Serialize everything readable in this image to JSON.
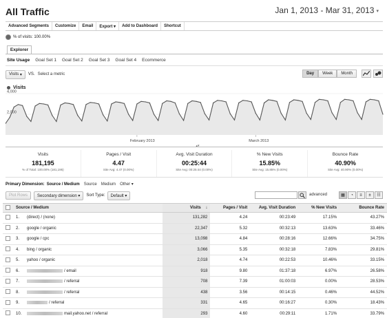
{
  "header": {
    "title": "All Traffic",
    "date_range": "Jan 1, 2013 - Mar 31, 2013"
  },
  "toolbar": [
    "Advanced Segments",
    "Customize",
    "Email",
    "Export ▾",
    "Add to Dashboard",
    "Shortcut"
  ],
  "segment": {
    "label": "% of visits: 100.00%"
  },
  "explorer_tab": "Explorer",
  "subtabs": [
    "Site Usage",
    "Goal Set 1",
    "Goal Set 2",
    "Goal Set 3",
    "Goal Set 4",
    "Ecommerce"
  ],
  "metric_row": {
    "metric_select": "Visits",
    "vs": "VS.",
    "select_metric": "Select a metric",
    "periods": [
      "Day",
      "Week",
      "Month"
    ],
    "active_period": "Day"
  },
  "chart_data": {
    "type": "line",
    "title": "",
    "legend": "Visits",
    "ylabel": "",
    "xlabel": "",
    "y_ticks": [
      "4,000",
      "2,000"
    ],
    "x_tick_labels": [
      "February 2013",
      "March 2013"
    ],
    "ylim": [
      0,
      4000
    ],
    "x": [
      "Jan 1",
      "Jan 2",
      "Jan 3",
      "Jan 4",
      "Jan 5",
      "Jan 6",
      "Jan 7",
      "Jan 8",
      "Jan 9",
      "Jan 10",
      "Jan 11",
      "Jan 12",
      "Jan 13",
      "Jan 14",
      "Jan 15",
      "Jan 16",
      "Jan 17",
      "Jan 18",
      "Jan 19",
      "Jan 20",
      "Jan 21",
      "Jan 22",
      "Jan 23",
      "Jan 24",
      "Jan 25",
      "Jan 26",
      "Jan 27",
      "Jan 28",
      "Jan 29",
      "Jan 30",
      "Jan 31",
      "Feb 1",
      "Feb 2",
      "Feb 3",
      "Feb 4",
      "Feb 5",
      "Feb 6",
      "Feb 7",
      "Feb 8",
      "Feb 9",
      "Feb 10",
      "Feb 11",
      "Feb 12",
      "Feb 13",
      "Feb 14",
      "Feb 15",
      "Feb 16",
      "Feb 17",
      "Feb 18",
      "Feb 19",
      "Feb 20",
      "Feb 21",
      "Feb 22",
      "Feb 23",
      "Feb 24",
      "Feb 25",
      "Feb 26",
      "Feb 27",
      "Feb 28",
      "Mar 1",
      "Mar 2",
      "Mar 3",
      "Mar 4",
      "Mar 5",
      "Mar 6",
      "Mar 7",
      "Mar 8",
      "Mar 9",
      "Mar 10",
      "Mar 11",
      "Mar 12",
      "Mar 13",
      "Mar 14",
      "Mar 15",
      "Mar 16",
      "Mar 17",
      "Mar 18",
      "Mar 19",
      "Mar 20",
      "Mar 21",
      "Mar 22",
      "Mar 23",
      "Mar 24",
      "Mar 25",
      "Mar 26",
      "Mar 27",
      "Mar 28",
      "Mar 29",
      "Mar 30",
      "Mar 31"
    ],
    "series": [
      {
        "name": "Visits",
        "values": [
          1100,
          1700,
          2700,
          2950,
          2850,
          1800,
          1300,
          2800,
          3050,
          3000,
          2900,
          1900,
          1300,
          2900,
          3100,
          3050,
          2950,
          1900,
          1350,
          2950,
          3150,
          3100,
          3000,
          1950,
          1350,
          3000,
          3200,
          3150,
          3050,
          2000,
          1400,
          3000,
          3250,
          3200,
          3100,
          2000,
          1400,
          3050,
          3300,
          3250,
          3100,
          2050,
          1400,
          3050,
          3300,
          3250,
          3150,
          2050,
          1450,
          3100,
          3350,
          3300,
          3200,
          2050,
          1450,
          3100,
          3350,
          3300,
          3200,
          2100,
          1450,
          3100,
          3400,
          3350,
          3250,
          2100,
          1450,
          3150,
          3400,
          3350,
          3250,
          2100,
          1500,
          3150,
          3450,
          3400,
          3300,
          2150,
          1500,
          3150,
          3450,
          3400,
          3300,
          2150,
          1500,
          3200,
          3450,
          3400,
          3300,
          2000
        ]
      }
    ],
    "color": "#555555",
    "fill": "#e9e9e9",
    "grid": true
  },
  "summary": [
    {
      "label": "Visits",
      "value": "181,195",
      "sub": "% of Total: 100.00% (181,195)"
    },
    {
      "label": "Pages / Visit",
      "value": "4.47",
      "sub": "Site Avg: 4.47 (0.00%)"
    },
    {
      "label": "Avg. Visit Duration",
      "value": "00:25:44",
      "sub": "Site Avg: 00:25:44 (0.00%)"
    },
    {
      "label": "% New Visits",
      "value": "15.85%",
      "sub": "Site Avg: 15.85% (0.00%)"
    },
    {
      "label": "Bounce Rate",
      "value": "40.90%",
      "sub": "Site Avg: 40.90% (0.00%)"
    }
  ],
  "primary_dimension": {
    "label": "Primary Dimension:",
    "options": [
      "Source / Medium",
      "Source",
      "Medium",
      "Other ▾"
    ],
    "active": "Source / Medium"
  },
  "controls": {
    "plot_rows": "Plot Rows",
    "secondary_dimension": "Secondary dimension ▾",
    "sort_type_label": "Sort Type:",
    "sort_type_value": "Default ▾",
    "search_placeholder": "",
    "advanced": "advanced"
  },
  "table": {
    "columns": [
      "Source / Medium",
      "Visits",
      "Pages / Visit",
      "Avg. Visit Duration",
      "% New Visits",
      "Bounce Rate"
    ],
    "sort_indicator": "↓",
    "rows": [
      {
        "n": "1.",
        "source": "(direct) / (none)",
        "visits": "131,282",
        "ppv": "4.24",
        "dur": "00:23:49",
        "new": "17.15%",
        "bounce": "43.27%"
      },
      {
        "n": "2.",
        "source": "google / organic",
        "visits": "22,347",
        "ppv": "5.32",
        "dur": "00:32:13",
        "new": "13.63%",
        "bounce": "33.46%"
      },
      {
        "n": "3.",
        "source": "google / cpc",
        "visits": "13,098",
        "ppv": "4.84",
        "dur": "00:28:16",
        "new": "12.66%",
        "bounce": "34.75%"
      },
      {
        "n": "4.",
        "source": "bing / organic",
        "visits": "3,066",
        "ppv": "5.35",
        "dur": "00:32:18",
        "new": "7.83%",
        "bounce": "29.81%"
      },
      {
        "n": "5.",
        "source": "yahoo / organic",
        "visits": "2,018",
        "ppv": "4.74",
        "dur": "00:22:53",
        "new": "10.46%",
        "bounce": "33.15%"
      },
      {
        "n": "6.",
        "source": "/ email",
        "visits": "918",
        "ppv": "9.80",
        "dur": "01:37:18",
        "new": "6.97%",
        "bounce": "26.58%",
        "blur": true
      },
      {
        "n": "7.",
        "source": "/ referral",
        "visits": "708",
        "ppv": "7.39",
        "dur": "01:00:03",
        "new": "0.00%",
        "bounce": "28.53%",
        "blur": true
      },
      {
        "n": "8.",
        "source": "/ referral",
        "visits": "438",
        "ppv": "3.56",
        "dur": "00:14:15",
        "new": "0.46%",
        "bounce": "44.52%",
        "blur": true
      },
      {
        "n": "9.",
        "source": "/ referral",
        "visits": "331",
        "ppv": "4.65",
        "dur": "00:16:27",
        "new": "0.30%",
        "bounce": "18.43%",
        "blur": true,
        "short": true
      },
      {
        "n": "10.",
        "source": "mail.yahoo.net / referral",
        "visits": "293",
        "ppv": "4.60",
        "dur": "00:29:11",
        "new": "1.71%",
        "bounce": "33.79%",
        "blur": true
      }
    ]
  }
}
